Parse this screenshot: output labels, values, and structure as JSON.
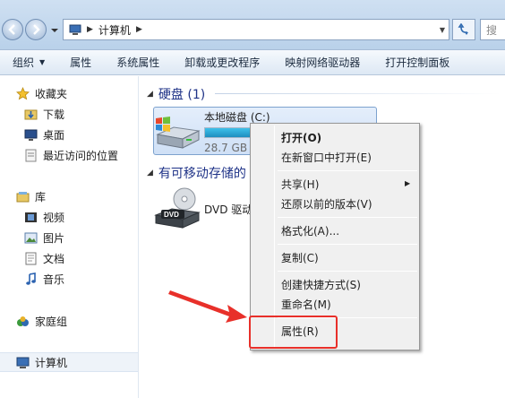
{
  "address": {
    "crumb": "计算机",
    "search_placeholder": "搜"
  },
  "toolbar": [
    {
      "label": "组织",
      "has_dropdown": true
    },
    {
      "label": "属性"
    },
    {
      "label": "系统属性"
    },
    {
      "label": "卸载或更改程序"
    },
    {
      "label": "映射网络驱动器"
    },
    {
      "label": "打开控制面板"
    }
  ],
  "nav": {
    "favorites": "收藏夹",
    "downloads": "下载",
    "desktop": "桌面",
    "recent": "最近访问的位置",
    "libraries": "库",
    "videos": "视频",
    "pictures": "图片",
    "documents": "文档",
    "music": "音乐",
    "homegroup": "家庭组",
    "computer": "计算机"
  },
  "main": {
    "hdd_group": "硬盘 (1)",
    "removable_group": "有可移动存储的",
    "drive_c": {
      "name": "本地磁盘 (C:)",
      "free": "28.7 GB",
      "used_fraction": 1.0
    },
    "dvd": {
      "name": "DVD 驱动",
      "icon_text": "DVD"
    }
  },
  "context_menu": {
    "open": "打开(O)",
    "open_new_window": "在新窗口中打开(E)",
    "share": "共享(H)",
    "restore": "还原以前的版本(V)",
    "format": "格式化(A)...",
    "copy": "复制(C)",
    "create_shortcut": "创建快捷方式(S)",
    "rename": "重命名(M)",
    "properties": "属性(R)"
  },
  "colors": {
    "annotation": "#e8302a",
    "group_header": "#1e3287"
  }
}
